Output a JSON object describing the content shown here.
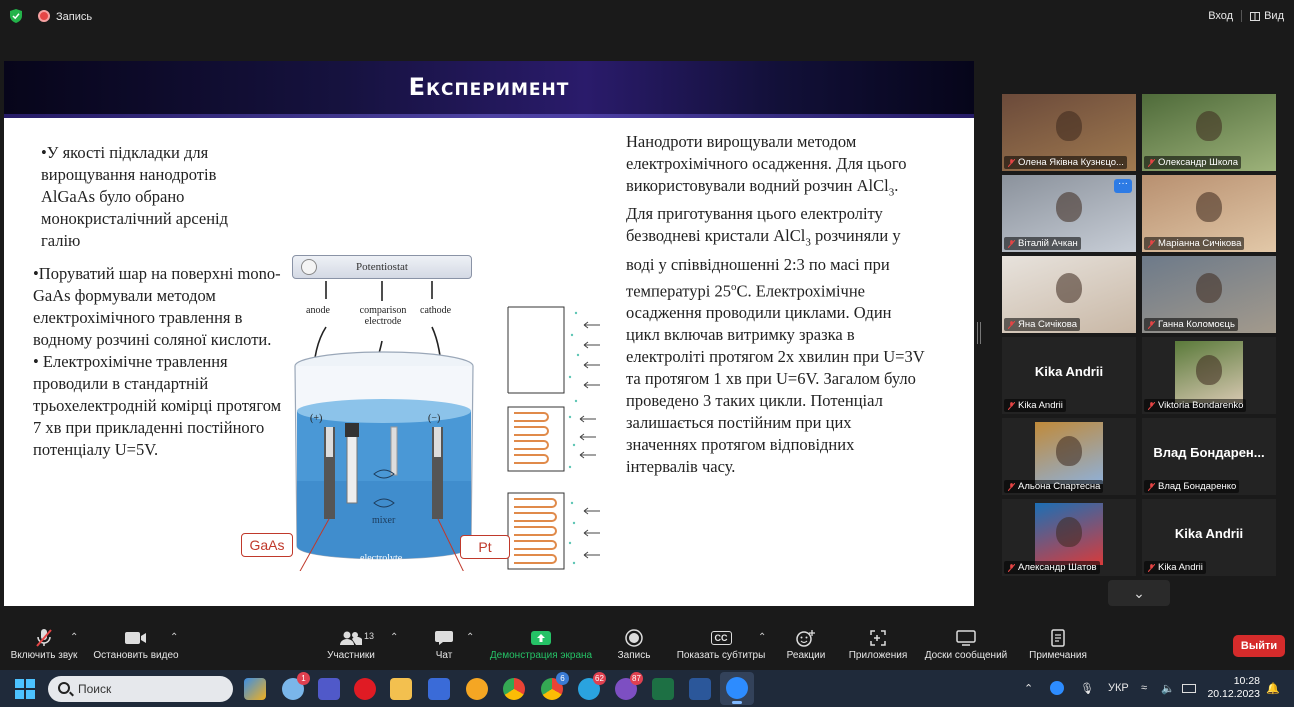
{
  "topbar": {
    "recording_label": "Запись",
    "login_label": "Вход",
    "view_label": "Вид"
  },
  "slide": {
    "title": "Експеримент",
    "left_text_1": "•У якості підкладки для вирощування нанодротів AlGaAs було обрано монокристалічний арсенід галію",
    "left_text_2a": "•Поруватий шар на поверхні mono-GaAs формували методом електрохімічного травлення в водному розчині соляної кислоти.",
    "left_text_2b": "• Електрохімічне травлення проводили в стандартній трьохелектродній комірці протягом 7 хв при прикладенні постійного потенціалу U=5V.",
    "right_text_a": "Нанодроти вирощували методом електрохімічного осадження. Для цього використовували водний розчин AlCl",
    "right_sub_1": "3",
    "right_text_b": ". Для приготування цього електроліту безводневі кристали AlCl",
    "right_sub_2": "3",
    "right_text_c": " розчиняли у воді у співвідношенні 2:3 по масі при температурі 25",
    "right_sup": "o",
    "right_text_d": "С. Електрохімічне осадження проводили циклами. Один цикл включав витримку зразка в електроліті протягом 2х хвилин при U=3V та протягом 1 хв при U=6V. Загалом було проведено 3 таких цикли. Потенціал залишається постійним при цих значеннях протягом відповідних інтервалів часу.",
    "diagram": {
      "potentiostat": "Potentiostat",
      "anode": "anode",
      "comparison": "comparison electrode",
      "cathode": "cathode",
      "plus": "(+)",
      "minus": "(−)",
      "mixer": "mixer",
      "electrolyte": "electrolyte",
      "gaas": "GaAs",
      "pt": "Pt"
    }
  },
  "participants": [
    {
      "name": "Олена Яківна Кузнєцо...",
      "kind": "video",
      "colors": [
        "#6b4a3a",
        "#a07a50"
      ]
    },
    {
      "name": "Олександр Школа",
      "kind": "video",
      "colors": [
        "#4f6b3a",
        "#9db27a"
      ]
    },
    {
      "name": "Віталій Ачкан",
      "kind": "video",
      "colors": [
        "#8b929c",
        "#c7cdd6"
      ]
    },
    {
      "name": "Маріанна Сичікова",
      "kind": "video",
      "colors": [
        "#b89070",
        "#e2c8a8"
      ]
    },
    {
      "name": "Яна Сичікова",
      "kind": "video",
      "colors": [
        "#e7e2dc",
        "#c9b8a6"
      ]
    },
    {
      "name": "Ганна Коломоєць",
      "kind": "video",
      "colors": [
        "#6d7a8a",
        "#a39a8c"
      ]
    },
    {
      "name": "Kika Andrii",
      "kind": "name",
      "big": "Kika Andrii"
    },
    {
      "name": "Viktoria Bondarenko",
      "kind": "photo",
      "colors": [
        "#5a7a3a",
        "#d6c7b0"
      ]
    },
    {
      "name": "Альона Спартесна",
      "kind": "photo",
      "colors": [
        "#c08a3a",
        "#8fb0d8"
      ]
    },
    {
      "name": "Влад Бондаренко",
      "kind": "name",
      "big": "Влад Бондарен..."
    },
    {
      "name": "Александр Шатов",
      "kind": "photo",
      "colors": [
        "#1c6fb5",
        "#d83b3b"
      ]
    },
    {
      "name": "Kika Andrii",
      "kind": "name",
      "big": "Kika Andrii"
    }
  ],
  "toolbar": {
    "audio": "Включить звук",
    "video": "Остановить видео",
    "participants": "Участники",
    "participants_count": "13",
    "chat": "Чат",
    "share": "Демонстрация экрана",
    "record": "Запись",
    "cc_icon_text": "CC",
    "captions": "Показать субтитры",
    "reactions": "Реакции",
    "apps": "Приложения",
    "whiteboards": "Доски сообщений",
    "notes": "Примечания",
    "leave": "Выйти"
  },
  "taskbar": {
    "search_placeholder": "Поиск",
    "badge_weather": "1",
    "badge_telegram": "62",
    "badge_viber": "87",
    "badge_chrome2": "6",
    "lang": "УКР",
    "time": "10:28",
    "date": "20.12.2023"
  }
}
